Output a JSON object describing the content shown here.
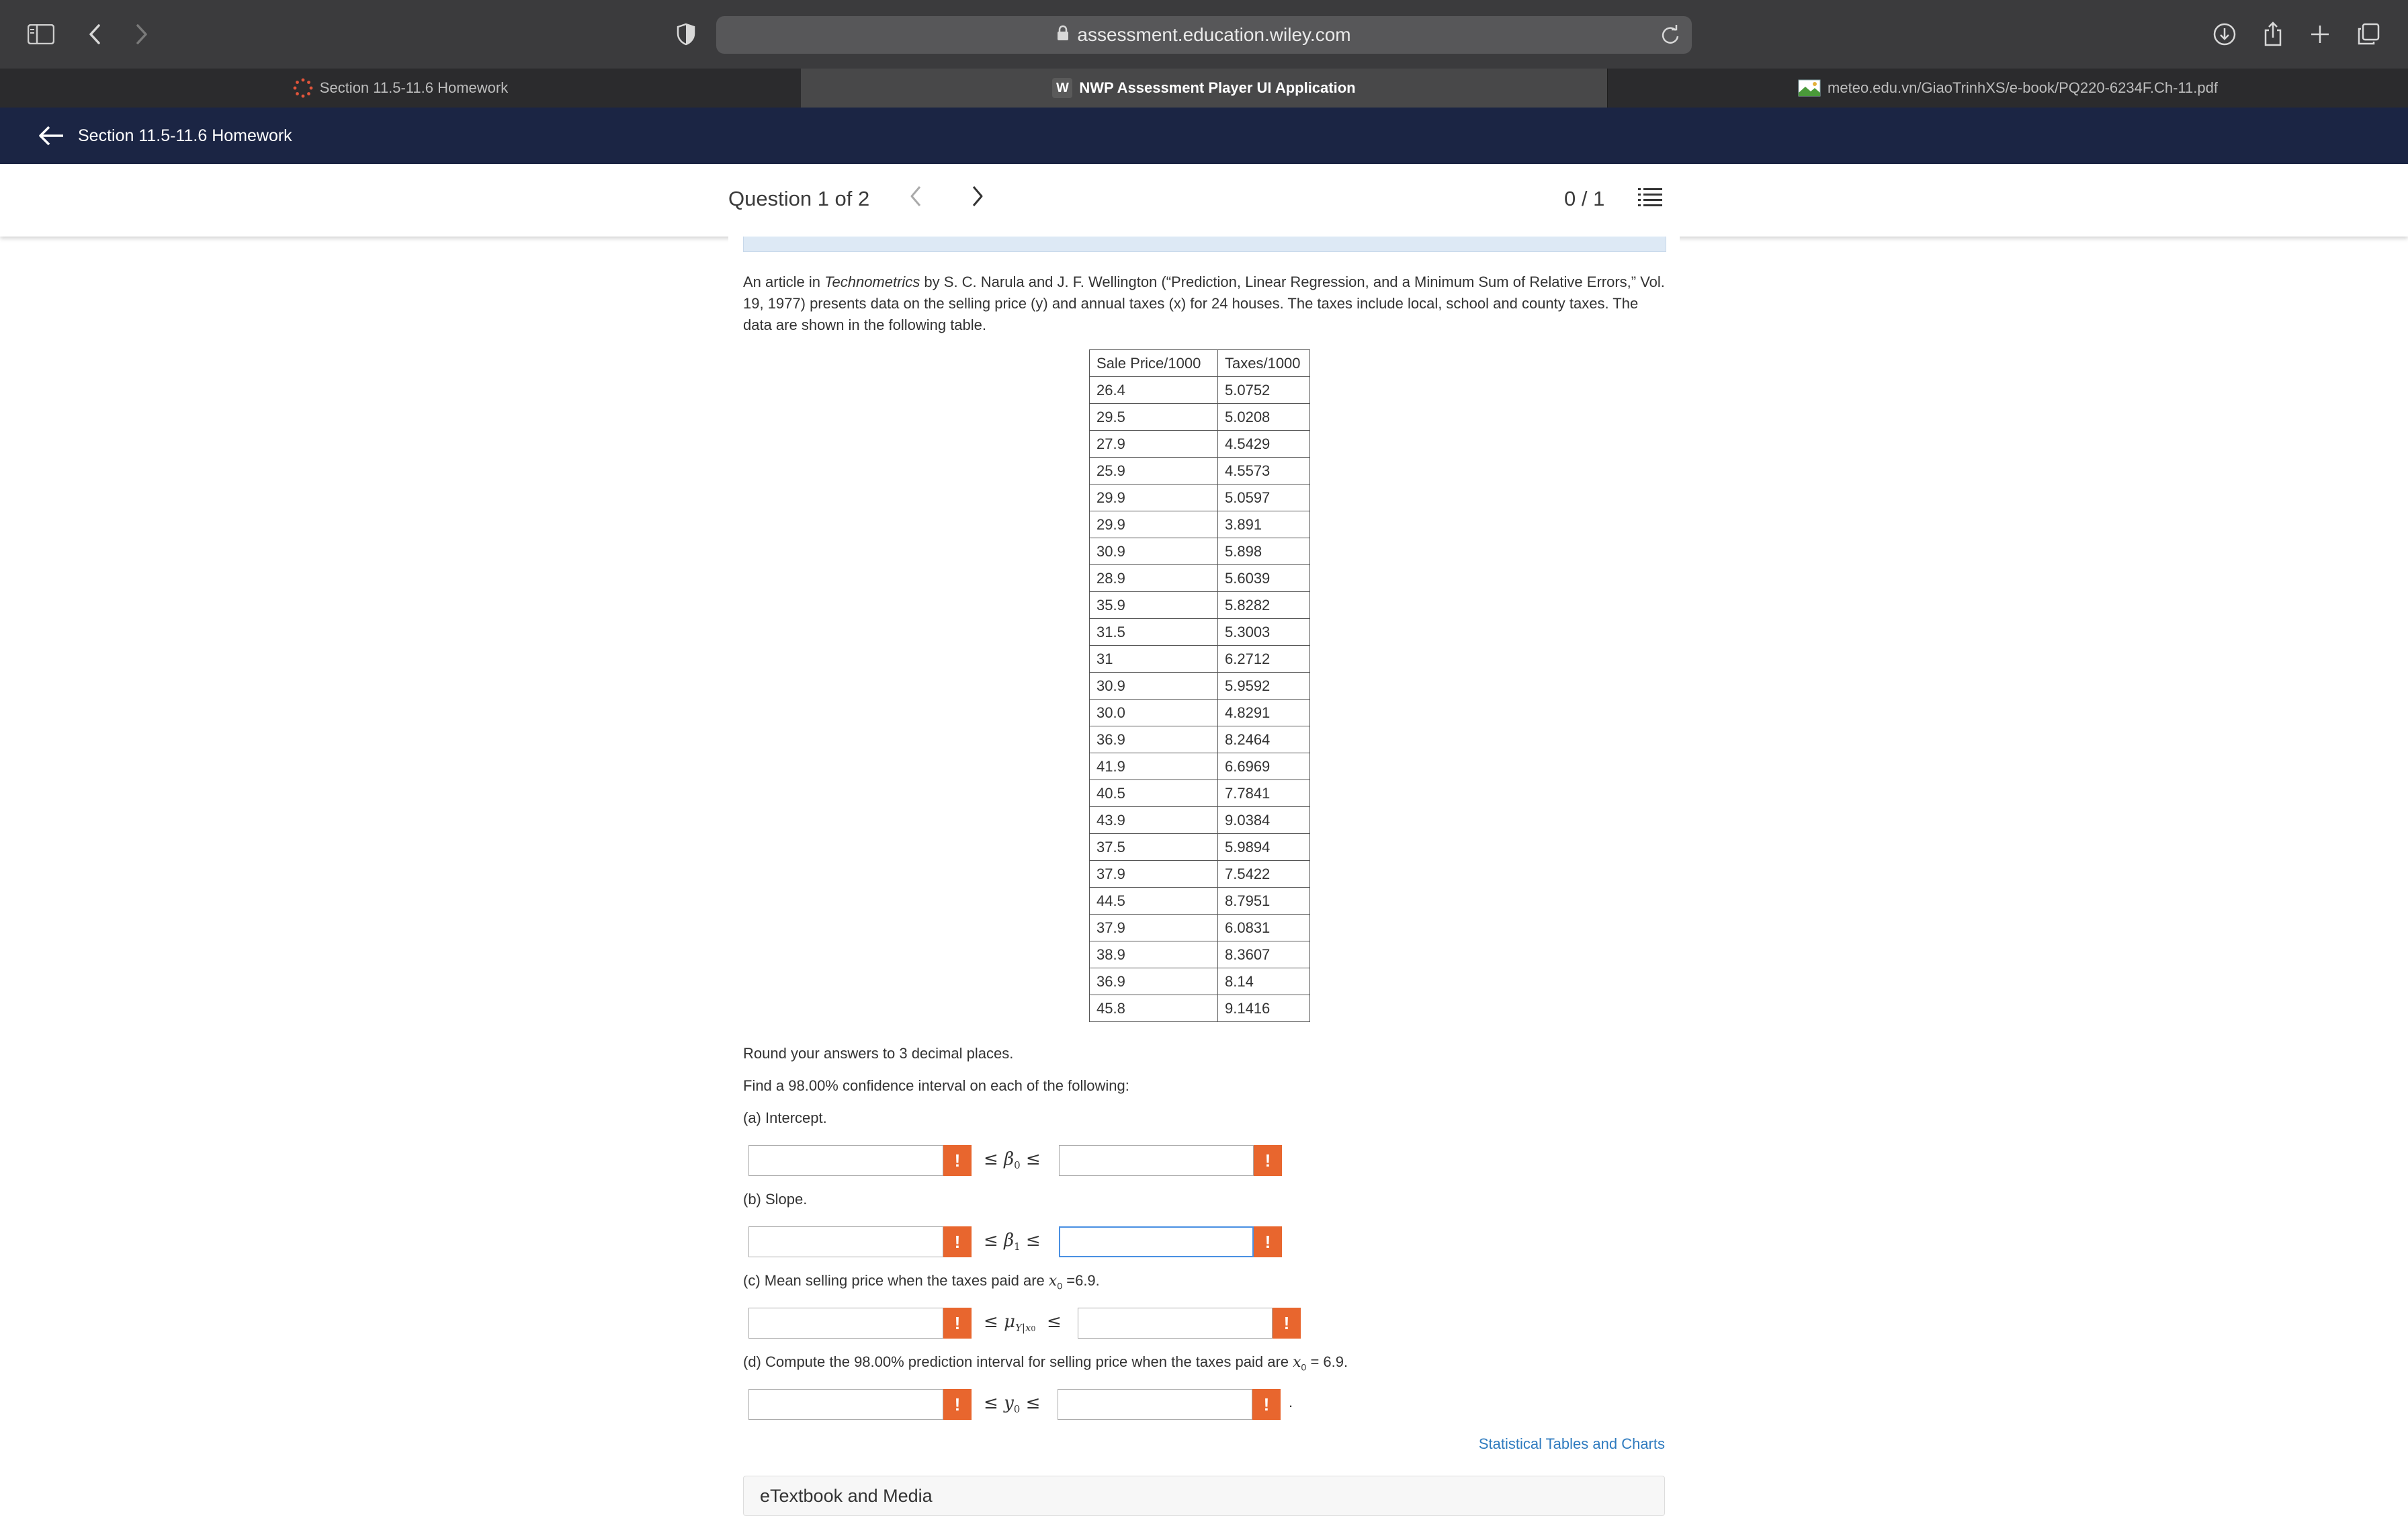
{
  "browser": {
    "url": "assessment.education.wiley.com",
    "tabs": [
      {
        "label": "Section 11.5-11.6 Homework",
        "favicon": "dots-circle-icon"
      },
      {
        "label": "NWP Assessment Player UI Application",
        "favicon_letter": "W"
      },
      {
        "label": "meteo.edu.vn/GiaoTrinhXS/e-book/PQ220-6234F.Ch-11.pdf",
        "favicon": "image-icon"
      }
    ]
  },
  "app_header": {
    "title": "Section 11.5-11.6 Homework"
  },
  "question_nav": {
    "label": "Question 1 of 2",
    "score": "0 / 1"
  },
  "question": {
    "intro_before": "An article in ",
    "intro_italic": "Technometrics",
    "intro_after": " by S. C. Narula and J. F. Wellington (“Prediction, Linear Regression, and a Minimum Sum of Relative Errors,” Vol. 19, 1977) presents data on the selling price (y) and annual taxes (x) for 24 houses. The taxes include local, school and county taxes. The data are shown in the following table.",
    "table": {
      "headers": [
        "Sale Price/1000",
        "Taxes/1000"
      ],
      "rows": [
        [
          "26.4",
          "5.0752"
        ],
        [
          "29.5",
          "5.0208"
        ],
        [
          "27.9",
          "4.5429"
        ],
        [
          "25.9",
          "4.5573"
        ],
        [
          "29.9",
          "5.0597"
        ],
        [
          "29.9",
          "3.891"
        ],
        [
          "30.9",
          "5.898"
        ],
        [
          "28.9",
          "5.6039"
        ],
        [
          "35.9",
          "5.8282"
        ],
        [
          "31.5",
          "5.3003"
        ],
        [
          "31",
          "6.2712"
        ],
        [
          "30.9",
          "5.9592"
        ],
        [
          "30.0",
          "4.8291"
        ],
        [
          "36.9",
          "8.2464"
        ],
        [
          "41.9",
          "6.6969"
        ],
        [
          "40.5",
          "7.7841"
        ],
        [
          "43.9",
          "9.0384"
        ],
        [
          "37.5",
          "5.9894"
        ],
        [
          "37.9",
          "7.5422"
        ],
        [
          "44.5",
          "8.7951"
        ],
        [
          "37.9",
          "6.0831"
        ],
        [
          "38.9",
          "8.3607"
        ],
        [
          "36.9",
          "8.14"
        ],
        [
          "45.8",
          "9.1416"
        ]
      ]
    },
    "round_note": "Round your answers to 3 decimal places.",
    "find_note": "Find a 98.00% confidence interval on each of the following:",
    "part_a": "(a) Intercept.",
    "part_b": "(b) Slope.",
    "part_c_before": "(c) Mean selling price when the taxes paid are ",
    "part_c_after": " =6.9.",
    "part_d_before": "(d) Compute the 98.00% prediction interval for selling price when the taxes paid are ",
    "part_d_after": " = 6.9.",
    "warn_symbol": "!",
    "leq": "≤",
    "trailing_period": "."
  },
  "footer": {
    "link": "Statistical Tables and Charts",
    "etextbook": "eTextbook and Media"
  }
}
